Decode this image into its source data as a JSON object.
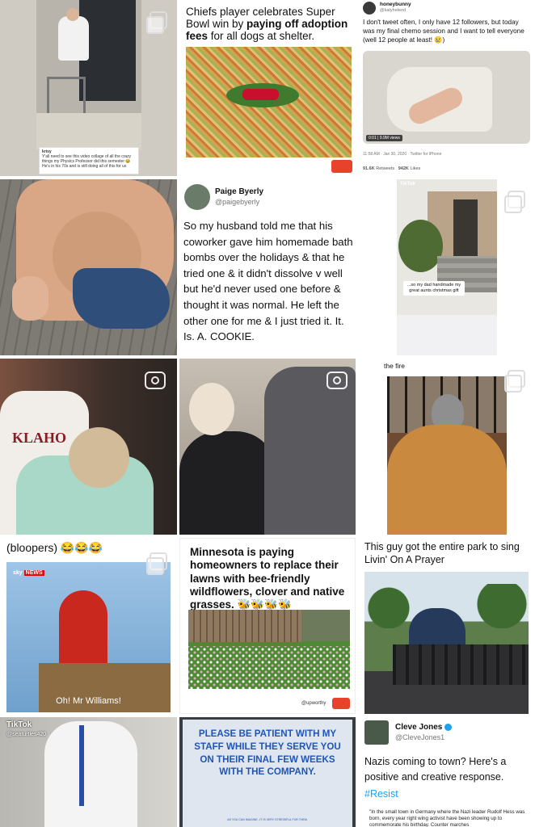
{
  "tiles": {
    "professor": {
      "caption_user": "krisy",
      "caption": "Y'all need to see this video collage of all the crazy things my Physics Professor did this semester 😂 He's in his 70s and is still doing all of this for us"
    },
    "chiefs": {
      "headline_plain": "Chiefs player celebrates Super Bowl win by ",
      "headline_bold": "paying off adoption fees",
      "headline_tail": " for all dogs at shelter."
    },
    "honeybunny": {
      "name": "honeybunny",
      "handle": "@katyhelend",
      "text": "I don't tweet often, I only have 12 followers, but today was my final chemo session and I want to tell everyone (well 12 people at least! 😢)",
      "video_time": "0:01",
      "views": "9.9M views",
      "timestamp": "11:58 AM · Jan 30, 2020 · Twitter for iPhone",
      "retweets": "91.6K",
      "retweets_label": "Retweets",
      "likes": "942K",
      "likes_label": "Likes"
    },
    "paige": {
      "name": "Paige Byerly",
      "handle": "@paigebyerly",
      "text": "So my husband told me that his coworker gave him homemade bath bombs over the holidays & that he tried one & it didn't dissolve v well but he'd never used one before & thought it was normal. He left the other one for me & I just tried it. It. Is. A. COOKIE."
    },
    "aunts": {
      "brand": "TikTok",
      "caption": "...so my dad handmade my great aunts christmas gift"
    },
    "koala": {
      "caption": "the fire"
    },
    "elmo": {
      "top_caption": "(bloopers) 😂😂😂",
      "brand": "sky",
      "brand_tag": "NEWS",
      "subtitle": "Oh! Mr Williams!"
    },
    "minnesota": {
      "headline": "Minnesota is paying homeowners to replace their lawns with bee-friendly wildflowers, clover and native grasses. 🐝🐝🐝🐝",
      "credit": "@upworthy"
    },
    "park": {
      "caption": "This guy got the entire park to sing Livin' On A Prayer"
    },
    "teacher": {
      "brand": "TikTok",
      "handle": "@seaturtles420"
    },
    "sign": {
      "text": "PLEASE BE PATIENT WITH MY STAFF WHILE THEY SERVE YOU ON THEIR FINAL FEW WEEKS WITH THE COMPANY.",
      "footnote": "AS YOU CAN IMAGINE...IT IS VERY STRESSFUL FOR THEM."
    },
    "cleve": {
      "name": "Cleve Jones",
      "handle": "@CleveJones1",
      "text": "Nazis coming to town? Here's a positive and creative response.",
      "hashtag": "#Resist",
      "quote": "\"In the small town in Germany where the Nazi leader Rudolf Hess was born, every year right wing activist have been showing up to commemorate his birthday. Counter marches"
    }
  },
  "colors": {
    "upworthy_red": "#e8412c",
    "twitter_blue": "#1da1f2",
    "sky_red": "#e10a0a",
    "sign_blue": "#1f56b5"
  }
}
